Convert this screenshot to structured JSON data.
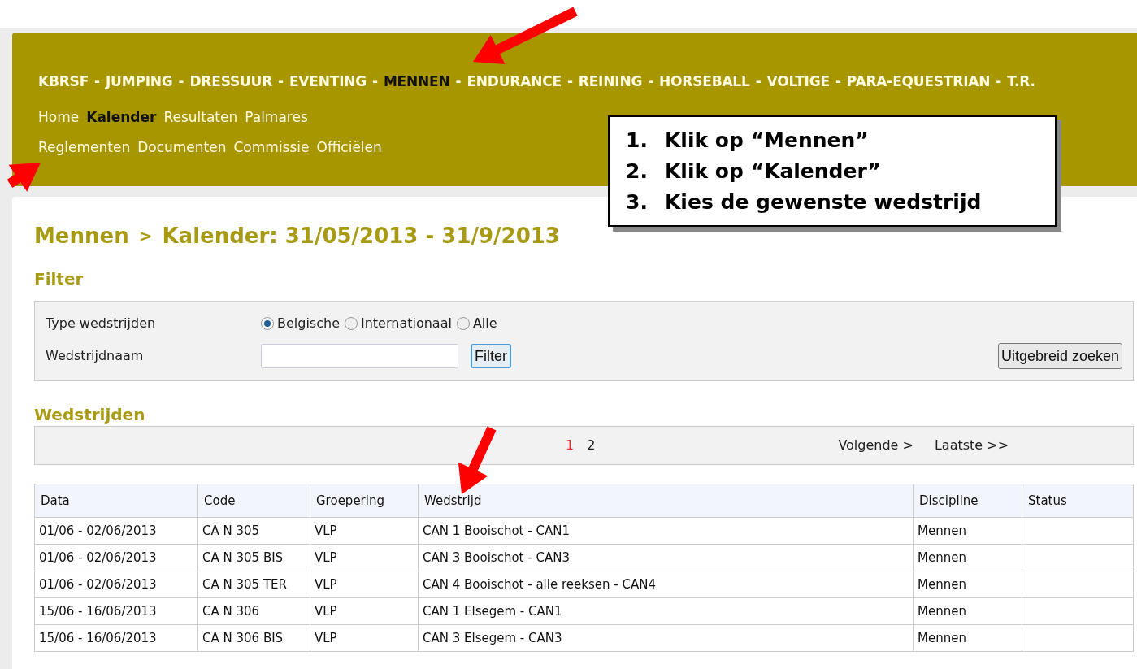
{
  "nav": {
    "sports": [
      {
        "label": "KBRSF",
        "selected": false
      },
      {
        "label": "JUMPING",
        "selected": false
      },
      {
        "label": "DRESSUUR",
        "selected": false
      },
      {
        "label": "EVENTING",
        "selected": false
      },
      {
        "label": "MENNEN",
        "selected": true
      },
      {
        "label": "ENDURANCE",
        "selected": false
      },
      {
        "label": "REINING",
        "selected": false
      },
      {
        "label": "HORSEBALL",
        "selected": false
      },
      {
        "label": "VOLTIGE",
        "selected": false
      },
      {
        "label": "PARA-EQUESTRIAN",
        "selected": false
      },
      {
        "label": "T.R.",
        "selected": false
      }
    ],
    "separator": "-",
    "link_rows": [
      [
        {
          "label": "Home",
          "selected": false
        },
        {
          "label": "Kalender",
          "selected": true
        },
        {
          "label": "Resultaten",
          "selected": false
        },
        {
          "label": "Palmares",
          "selected": false
        }
      ],
      [
        {
          "label": "Reglementen",
          "selected": false
        },
        {
          "label": "Documenten",
          "selected": false
        },
        {
          "label": "Commissie",
          "selected": false
        },
        {
          "label": "Officiëlen",
          "selected": false
        }
      ]
    ]
  },
  "callout": {
    "steps": [
      {
        "number": "1.",
        "text": "Klik op “Mennen”"
      },
      {
        "number": "2.",
        "text": "Klik op “Kalender”"
      },
      {
        "number": "3.",
        "text": "Kies de gewenste wedstrijd"
      }
    ]
  },
  "breadcrumb": [
    "Mennen",
    "Kalender: 31/05/2013 - 31/9/2013"
  ],
  "breadcrumb_separator": ">",
  "filter": {
    "title": "Filter",
    "type_label": "Type wedstrijden",
    "options": [
      {
        "label": "Belgische",
        "selected": true
      },
      {
        "label": "Internationaal",
        "selected": false
      },
      {
        "label": "Alle",
        "selected": false
      }
    ],
    "name_label": "Wedstrijdnaam",
    "filter_button": "Filter",
    "advanced_button": "Uitgebreid zoeken"
  },
  "competitions": {
    "title": "Wedstrijden",
    "pages": [
      {
        "label": "1",
        "selected": true
      },
      {
        "label": "2",
        "selected": false
      }
    ],
    "next": "Volgende >",
    "last": "Laatste >>",
    "columns": [
      "Data",
      "Code",
      "Groepering",
      "Wedstrijd",
      "Discipline",
      "Status"
    ],
    "rows": [
      [
        "01/06 - 02/06/2013",
        "CA N 305",
        "VLP",
        "CAN 1 Booischot - CAN1",
        "Mennen"
      ],
      [
        "01/06 - 02/06/2013",
        "CA N 305 BIS",
        "VLP",
        "CAN 3 Booischot - CAN3",
        "Mennen"
      ],
      [
        "01/06 - 02/06/2013",
        "CA N 305 TER",
        "VLP",
        "CAN 4 Booischot - alle reeksen - CAN4",
        "Mennen"
      ],
      [
        "15/06 - 16/06/2013",
        "CA N 306",
        "VLP",
        "CAN 1 Elsegem - CAN1",
        "Mennen"
      ],
      [
        "15/06 - 16/06/2013",
        "CA N 306 BIS",
        "VLP",
        "CAN 3 Elsegem - CAN3",
        "Mennen"
      ]
    ]
  }
}
